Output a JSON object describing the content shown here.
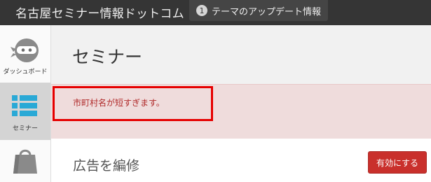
{
  "topbar": {
    "site_title": "名古屋セミナー情報ドットコム",
    "update_count": "1",
    "update_label": "テーマのアップデート情報"
  },
  "sidebar": {
    "items": [
      {
        "label": "ダッシュボード",
        "icon": "ninja-icon"
      },
      {
        "label": "セミナー",
        "icon": "list-icon"
      },
      {
        "label": "",
        "icon": "shopping-bag-icon"
      }
    ]
  },
  "main": {
    "page_title": "セミナー",
    "error_message": "市町村名が短すぎます。",
    "panel_title": "広告を編修",
    "activate_button": "有効にする"
  },
  "colors": {
    "topbar": "#353535",
    "accent_blue": "#29a9d6",
    "error_bg": "#efdcdc",
    "error_text": "#b02a2a",
    "highlight": "#e60000",
    "button_red": "#c9302c"
  }
}
